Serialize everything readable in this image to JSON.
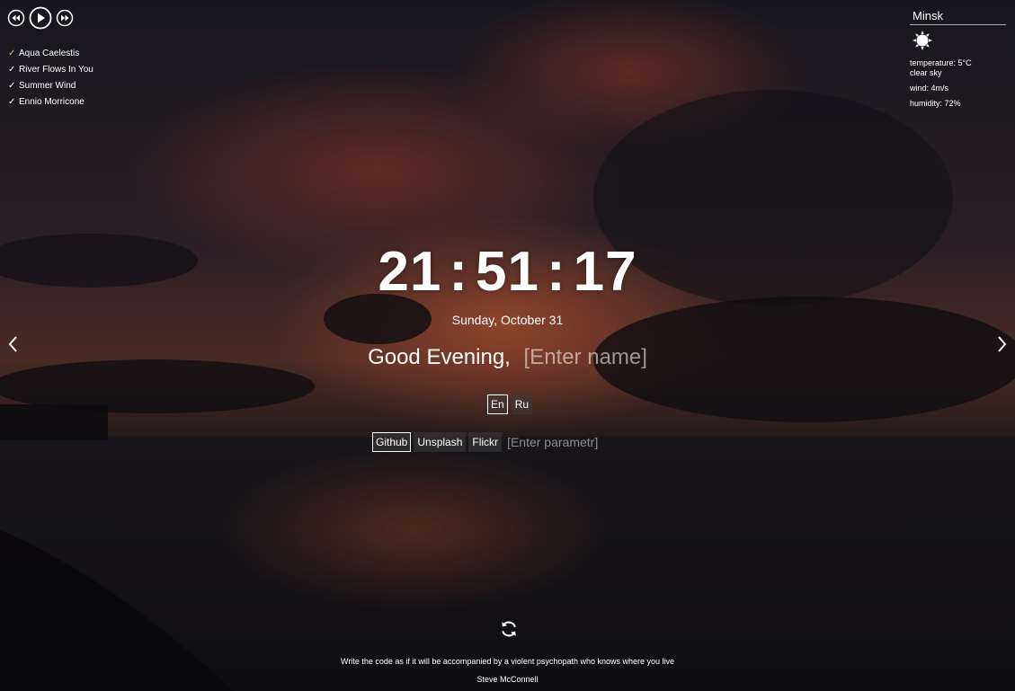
{
  "player": {
    "prev_icon": "skip-back-icon",
    "play_icon": "play-icon",
    "next_icon": "skip-forward-icon",
    "playlist": [
      {
        "title": "Aqua Caelestis",
        "active": true
      },
      {
        "title": "River Flows In You",
        "active": false
      },
      {
        "title": "Summer Wind",
        "active": false
      },
      {
        "title": "Ennio Morricone",
        "active": false
      }
    ]
  },
  "weather": {
    "city": "Minsk",
    "icon": "sun-icon",
    "temperature": "temperature: 5°C",
    "description": "clear sky",
    "wind": "wind: 4m/s",
    "humidity": "humidity: 72%"
  },
  "clock": {
    "hours": "21",
    "minutes": "51",
    "seconds": "17",
    "separator": ":"
  },
  "date": "Sunday, October 31",
  "greeting": {
    "text": "Good Evening,",
    "name_placeholder": "[Enter name]"
  },
  "language": {
    "options": [
      "En",
      "Ru"
    ],
    "selected": "En"
  },
  "image_source": {
    "options": [
      "Github",
      "Unsplash",
      "Flickr"
    ],
    "selected": "Github",
    "param_placeholder": "[Enter parametr]"
  },
  "quote": {
    "text": "Write the code as if it will be accompanied by a violent psychopath who knows where you live",
    "author": "Steve McConnell"
  },
  "colors": {
    "accent_check": "#d8c27a",
    "text": "#ffffff"
  }
}
